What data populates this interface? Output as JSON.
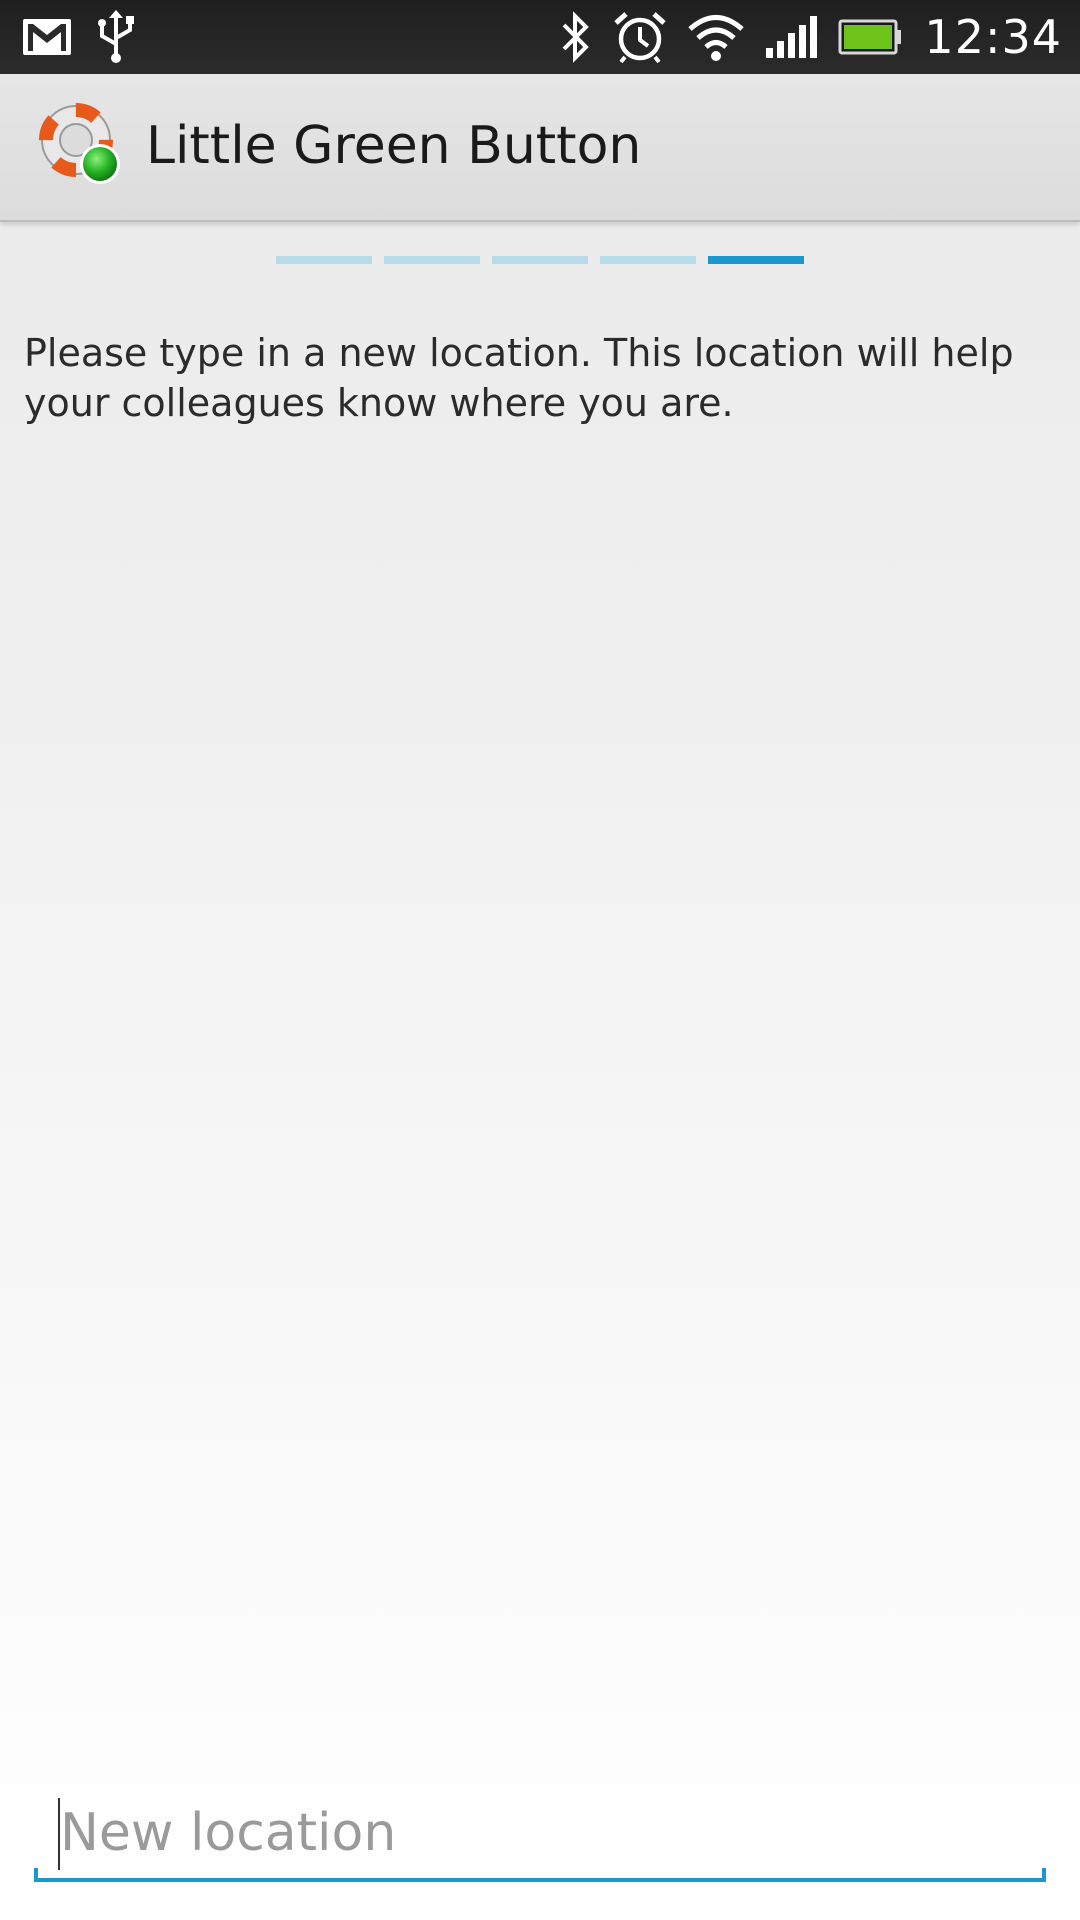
{
  "status_bar": {
    "time": "12:34",
    "left_icons": [
      "gmail-icon",
      "usb-icon"
    ],
    "right_icons": [
      "bluetooth-icon",
      "alarm-icon",
      "wifi-icon",
      "signal-icon",
      "battery-icon"
    ],
    "battery_color": "#6fc41c"
  },
  "action_bar": {
    "title": "Little Green Button",
    "logo_icon": "lifebuoy-green-dot-icon"
  },
  "pager": {
    "total_steps": 5,
    "current_step": 5,
    "inactive_color": "#b7dbe8",
    "active_color": "#1a97cc"
  },
  "content": {
    "instruction": "Please type in a new location. This location will help your colleagues know where you are."
  },
  "input": {
    "placeholder": "New location",
    "value": ""
  },
  "colors": {
    "accent": "#1a97cc"
  }
}
